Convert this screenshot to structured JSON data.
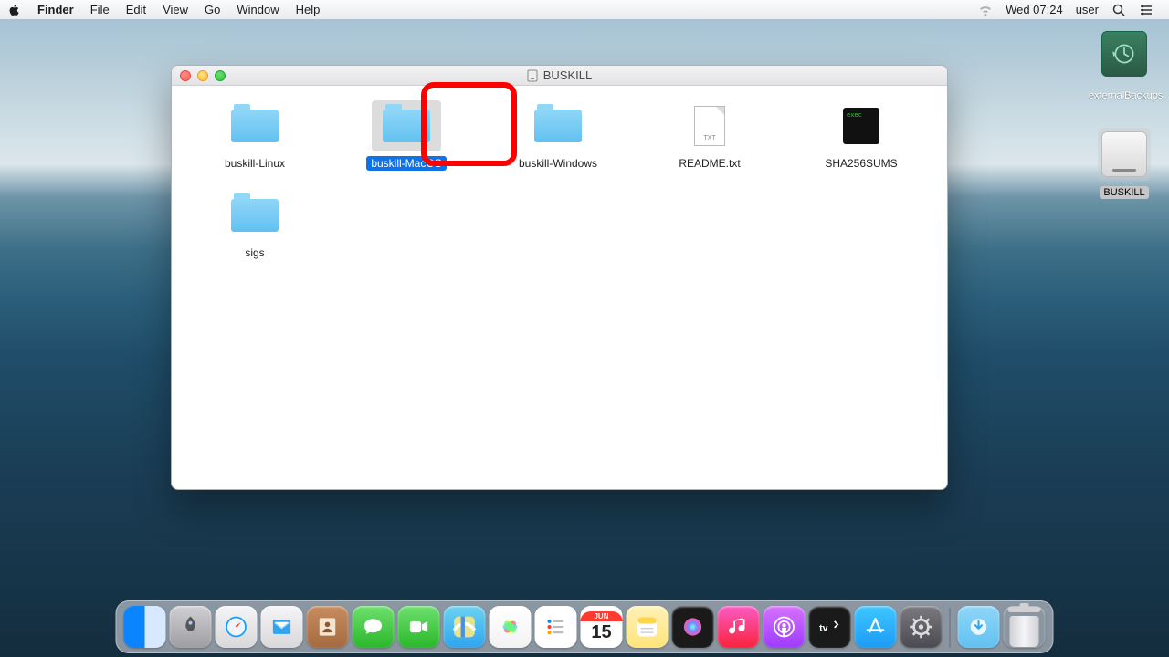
{
  "menubar": {
    "app_name": "Finder",
    "items": [
      "File",
      "Edit",
      "View",
      "Go",
      "Window",
      "Help"
    ],
    "clock": "Wed 07:24",
    "user": "user"
  },
  "desktop": {
    "icons": [
      {
        "name": "externalBackups",
        "type": "timemachine"
      },
      {
        "name": "BUSKILL",
        "type": "disk",
        "selected": true
      }
    ]
  },
  "finder": {
    "title": "BUSKILL",
    "items": [
      {
        "name": "buskill-Linux",
        "type": "folder"
      },
      {
        "name": "buskill-MacOS",
        "type": "folder",
        "selected": true,
        "highlight": true
      },
      {
        "name": "buskill-Windows",
        "type": "folder"
      },
      {
        "name": "README.txt",
        "type": "txt"
      },
      {
        "name": "SHA256SUMS",
        "type": "exec"
      },
      {
        "name": "sigs",
        "type": "folder"
      }
    ]
  },
  "dock": {
    "calendar": {
      "month": "JUN",
      "day": "15"
    },
    "apps": [
      "Finder",
      "Launchpad",
      "Safari",
      "Mail",
      "Contacts",
      "Messages",
      "FaceTime",
      "Maps",
      "Photos",
      "Reminders",
      "Calendar",
      "Notes",
      "Siri",
      "Music",
      "Podcasts",
      "TV",
      "App Store",
      "System Preferences"
    ],
    "right": [
      "Downloads",
      "Trash"
    ]
  }
}
